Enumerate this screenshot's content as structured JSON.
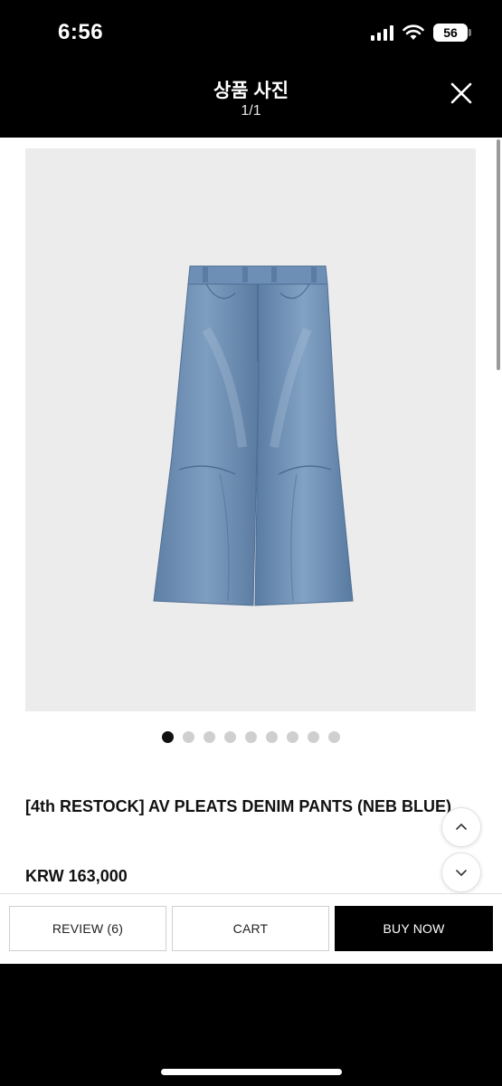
{
  "status_bar": {
    "time": "6:56",
    "battery": "56",
    "icons": [
      "signal-icon",
      "wifi-icon",
      "battery-icon"
    ]
  },
  "header": {
    "title": "상품 사진",
    "counter": "1/1",
    "close_icon": "close-icon"
  },
  "gallery": {
    "image_alt": "jeans-photo",
    "dot_count": 9,
    "active_dot": 0
  },
  "product": {
    "title": "[4th RESTOCK] AV PLEATS DENIM PANTS (NEB BLUE)",
    "price": "KRW 163,000"
  },
  "actions": {
    "review": "REVIEW (6)",
    "cart": "CART",
    "buy": "BUY NOW"
  },
  "colors": {
    "header_bg": "#000000",
    "photo_bg": "#ececec",
    "denim": "#6b8eb3",
    "buy_button_bg": "#000000"
  }
}
